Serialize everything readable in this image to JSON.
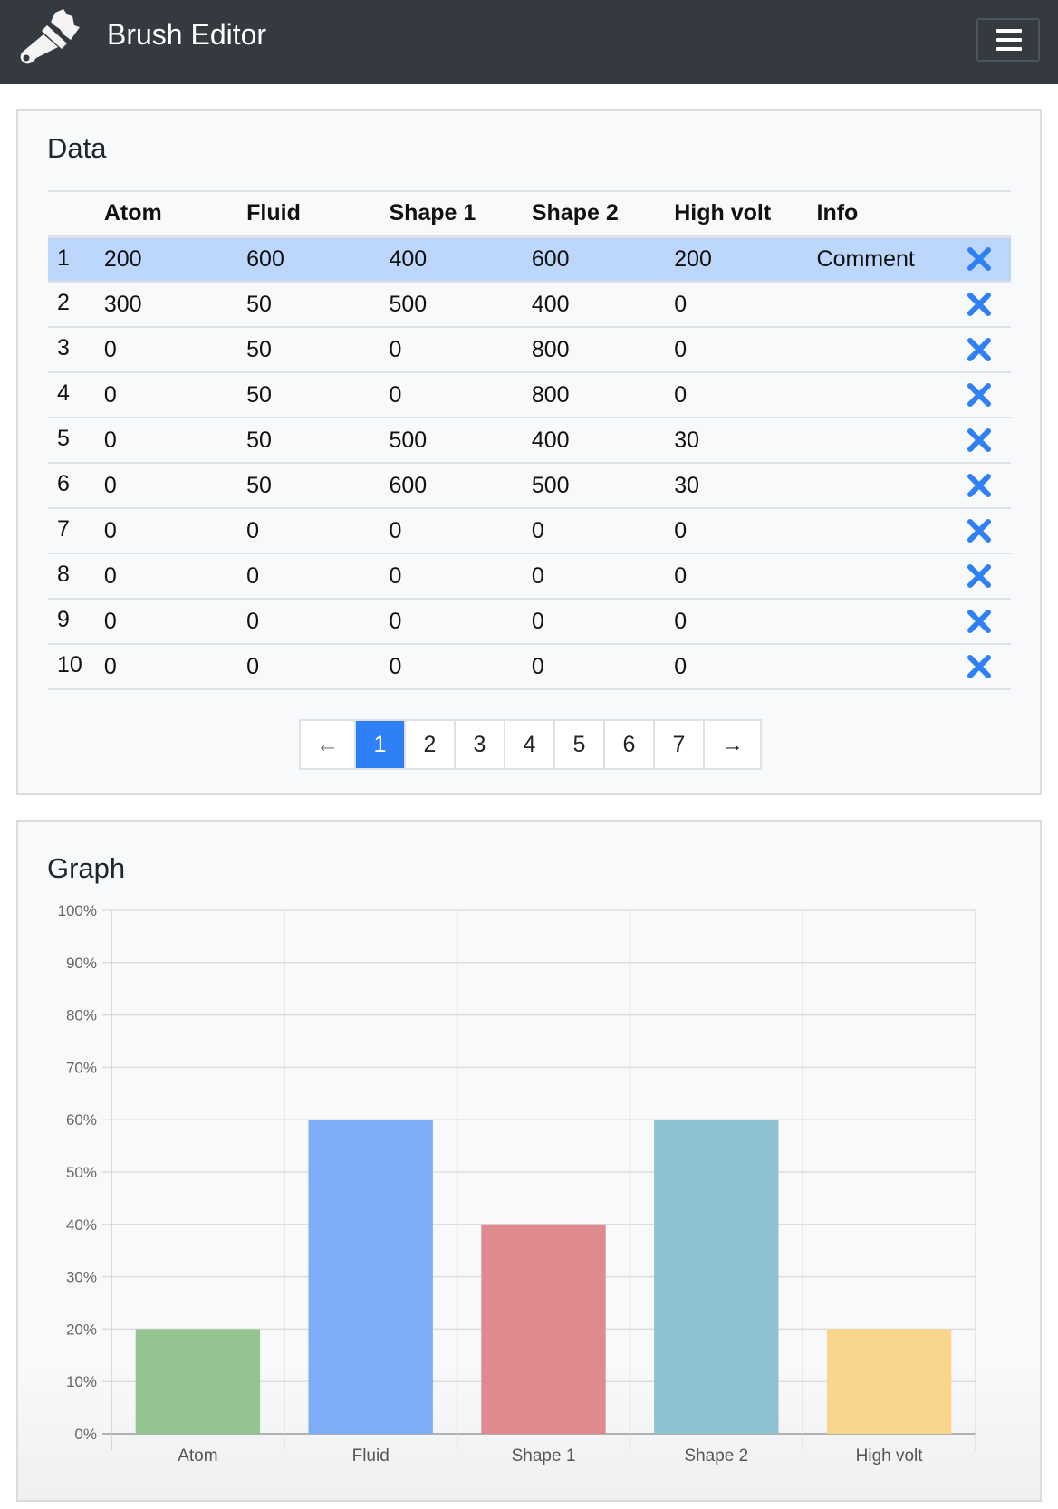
{
  "navbar": {
    "title": "Brush Editor",
    "brand_icon": "paintbrush-icon",
    "menu_icon": "hamburger-menu-icon"
  },
  "data_card": {
    "title": "Data",
    "columns": [
      "",
      "Atom",
      "Fluid",
      "Shape 1",
      "Shape 2",
      "High volt",
      "Info",
      ""
    ],
    "rows": [
      {
        "index": "1",
        "values": [
          "200",
          "600",
          "400",
          "600",
          "200"
        ],
        "info": "Comment",
        "selected": true
      },
      {
        "index": "2",
        "values": [
          "300",
          "50",
          "500",
          "400",
          "0"
        ],
        "info": "",
        "selected": false
      },
      {
        "index": "3",
        "values": [
          "0",
          "50",
          "0",
          "800",
          "0"
        ],
        "info": "",
        "selected": false
      },
      {
        "index": "4",
        "values": [
          "0",
          "50",
          "0",
          "800",
          "0"
        ],
        "info": "",
        "selected": false
      },
      {
        "index": "5",
        "values": [
          "0",
          "50",
          "500",
          "400",
          "30"
        ],
        "info": "",
        "selected": false
      },
      {
        "index": "6",
        "values": [
          "0",
          "50",
          "600",
          "500",
          "30"
        ],
        "info": "",
        "selected": false
      },
      {
        "index": "7",
        "values": [
          "0",
          "0",
          "0",
          "0",
          "0"
        ],
        "info": "",
        "selected": false
      },
      {
        "index": "8",
        "values": [
          "0",
          "0",
          "0",
          "0",
          "0"
        ],
        "info": "",
        "selected": false
      },
      {
        "index": "9",
        "values": [
          "0",
          "0",
          "0",
          "0",
          "0"
        ],
        "info": "",
        "selected": false
      },
      {
        "index": "10",
        "values": [
          "0",
          "0",
          "0",
          "0",
          "0"
        ],
        "info": "",
        "selected": false
      }
    ],
    "delete_icon": "close-x-icon",
    "delete_color": "#2f80f5",
    "pagination": {
      "prev": "←",
      "next": "→",
      "pages": [
        "1",
        "2",
        "3",
        "4",
        "5",
        "6",
        "7"
      ],
      "current": "1"
    }
  },
  "graph_card": {
    "title": "Graph"
  },
  "chart_data": {
    "type": "bar",
    "title": "",
    "xlabel": "",
    "ylabel": "",
    "categories": [
      "Atom",
      "Fluid",
      "Shape 1",
      "Shape 2",
      "High volt"
    ],
    "values": [
      20,
      60,
      40,
      60,
      20
    ],
    "unit": "%",
    "ylim": [
      0,
      100
    ],
    "yticks": [
      "0%",
      "10%",
      "20%",
      "30%",
      "40%",
      "50%",
      "60%",
      "70%",
      "80%",
      "90%",
      "100%"
    ],
    "colors": [
      "#94c591",
      "#7daef5",
      "#de8a8e",
      "#8fc2d0",
      "#f8d68c"
    ],
    "grid": true,
    "legend": "none"
  },
  "colors": {
    "navbar_bg": "#343a40",
    "accent": "#2f80f5",
    "selected_row": "#bcd7fb",
    "card_bg": "#f8f9fa"
  }
}
